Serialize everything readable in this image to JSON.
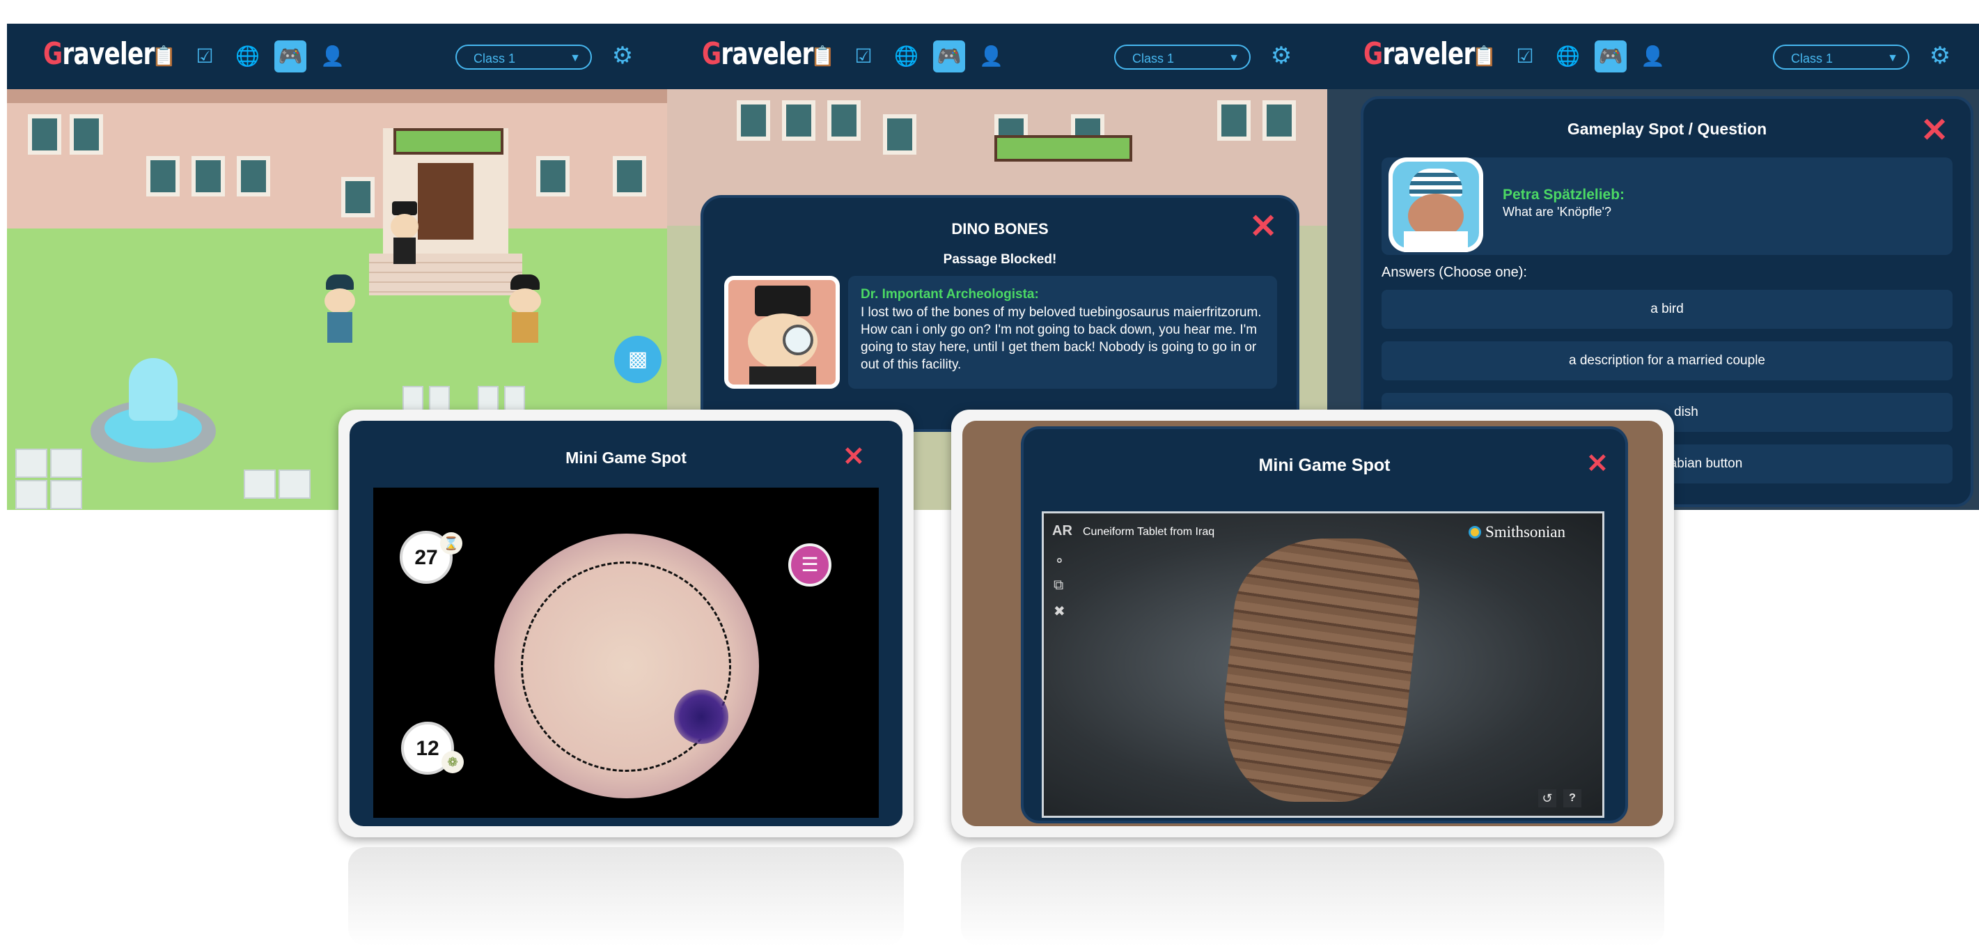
{
  "app": {
    "logo_first_letter": "G",
    "logo_rest": "raveler",
    "class_select": "Class 1",
    "nav_icons": [
      "clipboard-icon",
      "checklist-icon",
      "globe-icon",
      "gamepad-icon",
      "user-icon"
    ]
  },
  "panel2": {
    "dialog_title": "DINO BONES",
    "dialog_subtitle": "Passage Blocked!",
    "speaker": "Dr. Important Archeologista:",
    "message": "I lost two of the bones of my beloved tuebingosaurus maierfritzorum. How can i only go on? I'm not going to back down, you hear me. I'm going to stay here, until I get them back! Nobody is going to go in or out of this facility."
  },
  "panel3": {
    "dialog_title": "Gameplay Spot / Question",
    "speaker": "Petra Spätzlelieb:",
    "question": "What are 'Knöpfle'?",
    "answers_label": "Answers (Choose one):",
    "answers": [
      "a bird",
      "a description for a married couple",
      "dish",
      "wabian button"
    ]
  },
  "tablet1": {
    "title": "Mini Game Spot",
    "timer_value": "27",
    "score_value": "12"
  },
  "tablet2": {
    "title": "Mini Game Spot",
    "ar_label": "AR",
    "model_title": "Cuneiform Tablet from Iraq",
    "brand": "Smithsonian",
    "help_label": "?"
  },
  "colors": {
    "navy": "#0f2d4a",
    "accent_blue": "#47b8f0",
    "accent_red": "#f0485a",
    "speaker_green": "#4cd964"
  }
}
